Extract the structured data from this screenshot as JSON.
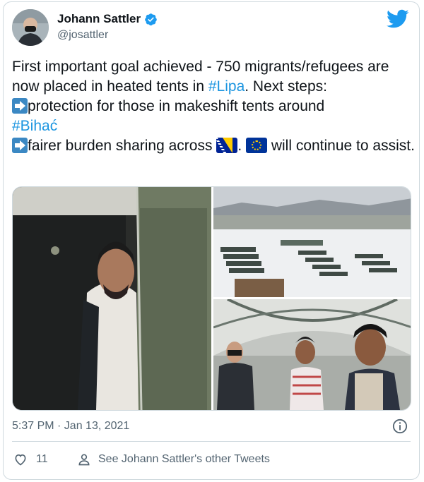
{
  "author": {
    "name": "Johann Sattler",
    "handle": "@josattler",
    "verified": true
  },
  "icons": {
    "header_logo": "twitter-bird-icon",
    "verified": "verified-badge-icon",
    "info": "info-icon",
    "like": "heart-icon",
    "profile": "person-icon",
    "arrow_emoji": "arrow-right-emoji",
    "flag_ba": "bosnia-herzegovina-flag-emoji",
    "flag_eu": "european-union-flag-emoji"
  },
  "tweet": {
    "line1": "First important goal achieved - 750 migrants/refugees are now placed in heated tents in ",
    "hashtag_lipa": "#Lipa",
    "line1_end": ". Next steps:",
    "step1": "protection for those in makeshift tents around",
    "hashtag_bihac": "#Bihać",
    "step2": "fairer burden sharing across ",
    "step2_mid": ". ",
    "step2_end": " will continue to assist."
  },
  "footer": {
    "timestamp": "5:37 PM · Jan 13, 2021",
    "like_count": "11",
    "other_tweets": "See Johann Sattler's other Tweets"
  },
  "colors": {
    "twitter_blue": "#1d9bf0",
    "hashtag": "#1b95e0",
    "muted": "#536471"
  }
}
